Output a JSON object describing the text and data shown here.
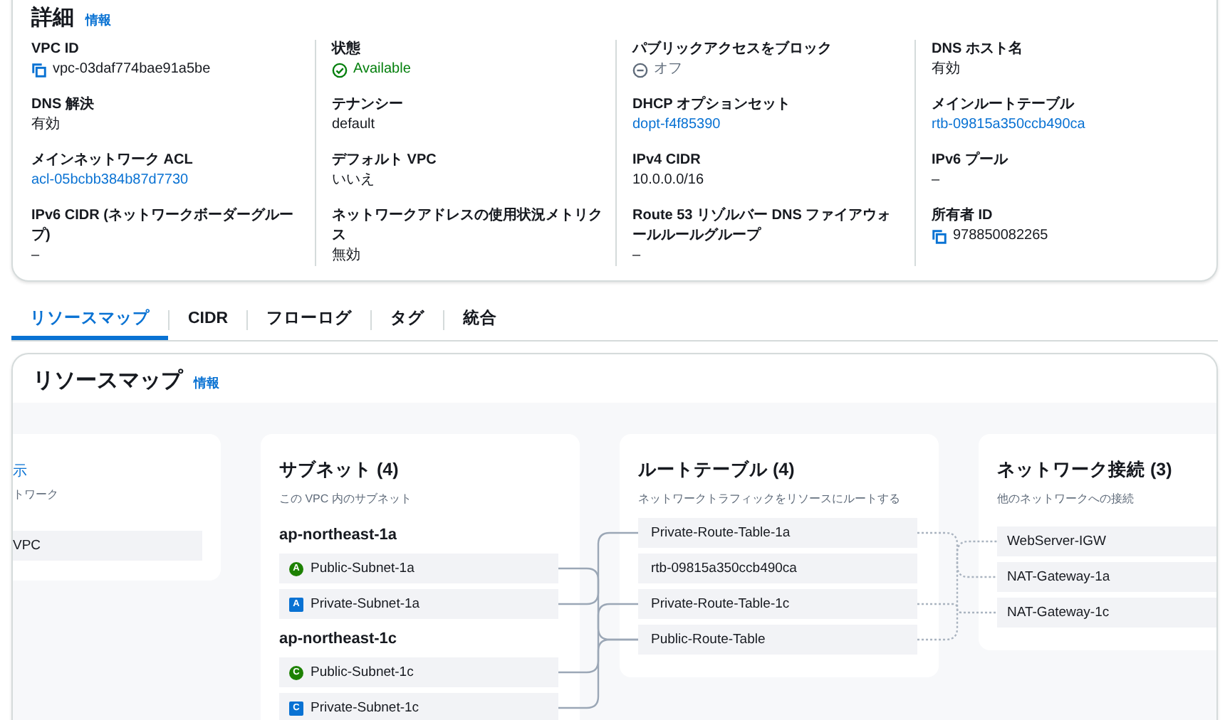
{
  "details": {
    "title": "詳細",
    "info": "情報",
    "columns": [
      [
        {
          "label": "VPC ID",
          "value": "vpc-03daf774bae91a5be",
          "kind": "copy"
        },
        {
          "label": "DNS 解決",
          "value": "有効",
          "kind": "text"
        },
        {
          "label": "メインネットワーク ACL",
          "value": "acl-05bcbb384b87d7730",
          "kind": "link"
        },
        {
          "label": "IPv6 CIDR (ネットワークボーダーグループ)",
          "value": "–",
          "kind": "text"
        }
      ],
      [
        {
          "label": "状態",
          "value": "Available",
          "kind": "status-ok"
        },
        {
          "label": "テナンシー",
          "value": "default",
          "kind": "text"
        },
        {
          "label": "デフォルト VPC",
          "value": "いいえ",
          "kind": "text"
        },
        {
          "label": "ネットワークアドレスの使用状況メトリクス",
          "value": "無効",
          "kind": "text"
        }
      ],
      [
        {
          "label": "パブリックアクセスをブロック",
          "value": "オフ",
          "kind": "status-off"
        },
        {
          "label": "DHCP オプションセット",
          "value": "dopt-f4f85390",
          "kind": "link"
        },
        {
          "label": "IPv4 CIDR",
          "value": "10.0.0.0/16",
          "kind": "text"
        },
        {
          "label": "Route 53 リゾルバー DNS ファイアウォールルールグループ",
          "value": "–",
          "kind": "text"
        }
      ],
      [
        {
          "label": "DNS ホスト名",
          "value": "有効",
          "kind": "text"
        },
        {
          "label": "メインルートテーブル",
          "value": "rtb-09815a350ccb490ca",
          "kind": "link"
        },
        {
          "label": "IPv6 プール",
          "value": "–",
          "kind": "text"
        },
        {
          "label": "所有者 ID",
          "value": "978850082265",
          "kind": "copy"
        }
      ]
    ]
  },
  "tabs": [
    {
      "label": "リソースマップ",
      "selected": true
    },
    {
      "label": "CIDR",
      "selected": false
    },
    {
      "label": "フローログ",
      "selected": false
    },
    {
      "label": "タグ",
      "selected": false
    },
    {
      "label": "統合",
      "selected": false
    }
  ],
  "resource_map": {
    "title": "リソースマップ",
    "info": "情報",
    "vpc_card": {
      "link": "示",
      "subtitle": "トワーク",
      "items": [
        "VPC"
      ]
    },
    "subnets": {
      "title": "サブネット (4)",
      "subtitle": "この VPC 内のサブネット",
      "zones": [
        {
          "name": "ap-northeast-1a",
          "items": [
            {
              "name": "Public-Subnet-1a",
              "badge": "A",
              "kind": "public"
            },
            {
              "name": "Private-Subnet-1a",
              "badge": "A",
              "kind": "private"
            }
          ]
        },
        {
          "name": "ap-northeast-1c",
          "items": [
            {
              "name": "Public-Subnet-1c",
              "badge": "C",
              "kind": "public"
            },
            {
              "name": "Private-Subnet-1c",
              "badge": "C",
              "kind": "private"
            }
          ]
        }
      ]
    },
    "route_tables": {
      "title": "ルートテーブル (4)",
      "subtitle": "ネットワークトラフィックをリソースにルートする",
      "items": [
        "Private-Route-Table-1a",
        "rtb-09815a350ccb490ca",
        "Private-Route-Table-1c",
        "Public-Route-Table"
      ]
    },
    "connections": {
      "title": "ネットワーク接続 (3)",
      "subtitle": "他のネットワークへの接続",
      "items": [
        "WebServer-IGW",
        "NAT-Gateway-1a",
        "NAT-Gateway-1c"
      ]
    }
  }
}
